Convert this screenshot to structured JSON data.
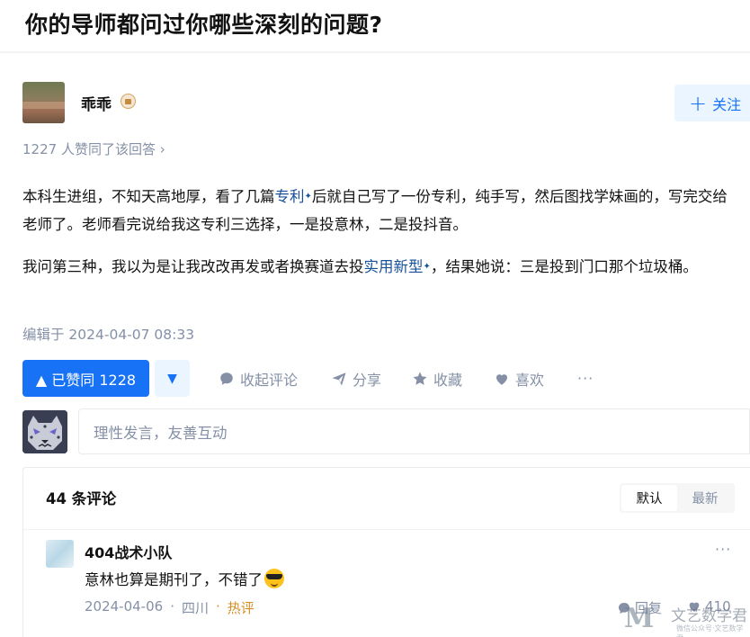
{
  "question": {
    "title": "你的导师都问过你哪些深刻的问题?"
  },
  "author": {
    "name": "乖乖",
    "badge_icon": "badge-icon",
    "follow_label": "关注"
  },
  "votes_line": "1227 人赞同了该回答 ›",
  "answer": {
    "p1_a": "本科生进组，不知天高地厚，看了几篇",
    "p1_kw": "专利",
    "p1_b": "后就自己写了一份专利，纯手写，然后图找学妹画的，写完交给老师了。老师看完说给我这专利三选择，一是投意林，二是投抖音。",
    "p2_a": "我问第三种，我以为是让我改改再发或者换赛道去投",
    "p2_kw": "实用新型",
    "p2_b": "，结果她说：三是投到门口那个垃圾桶。",
    "spark": "✦"
  },
  "edited": "编辑于 2024-04-07 08:33",
  "actions": {
    "vote_up": "▲ 已赞同 1228",
    "vote_down": "▼",
    "comment": "收起评论",
    "share": "分享",
    "favorite": "收藏",
    "like": "喜欢",
    "more": "···"
  },
  "reply_input": {
    "placeholder": "理性发言，友善互动"
  },
  "comments": {
    "count_label": "44 条评论",
    "sort_tabs": [
      "默认",
      "最新"
    ],
    "items": [
      {
        "author": "404战术小队",
        "text": "意林也算是期刊了，不错了",
        "date": "2024-04-06",
        "dot": "·",
        "location": "四川",
        "tag": "热评",
        "reply_label": "回复",
        "likes": "410",
        "more": "···"
      }
    ]
  },
  "watermark": {
    "mark": "M",
    "text": "文艺数学君",
    "sub": "微信公众号·文艺数学君"
  },
  "colors": {
    "accent": "#1772f6",
    "muted": "#8590a6",
    "link": "#175199",
    "hot": "#d38f26"
  }
}
